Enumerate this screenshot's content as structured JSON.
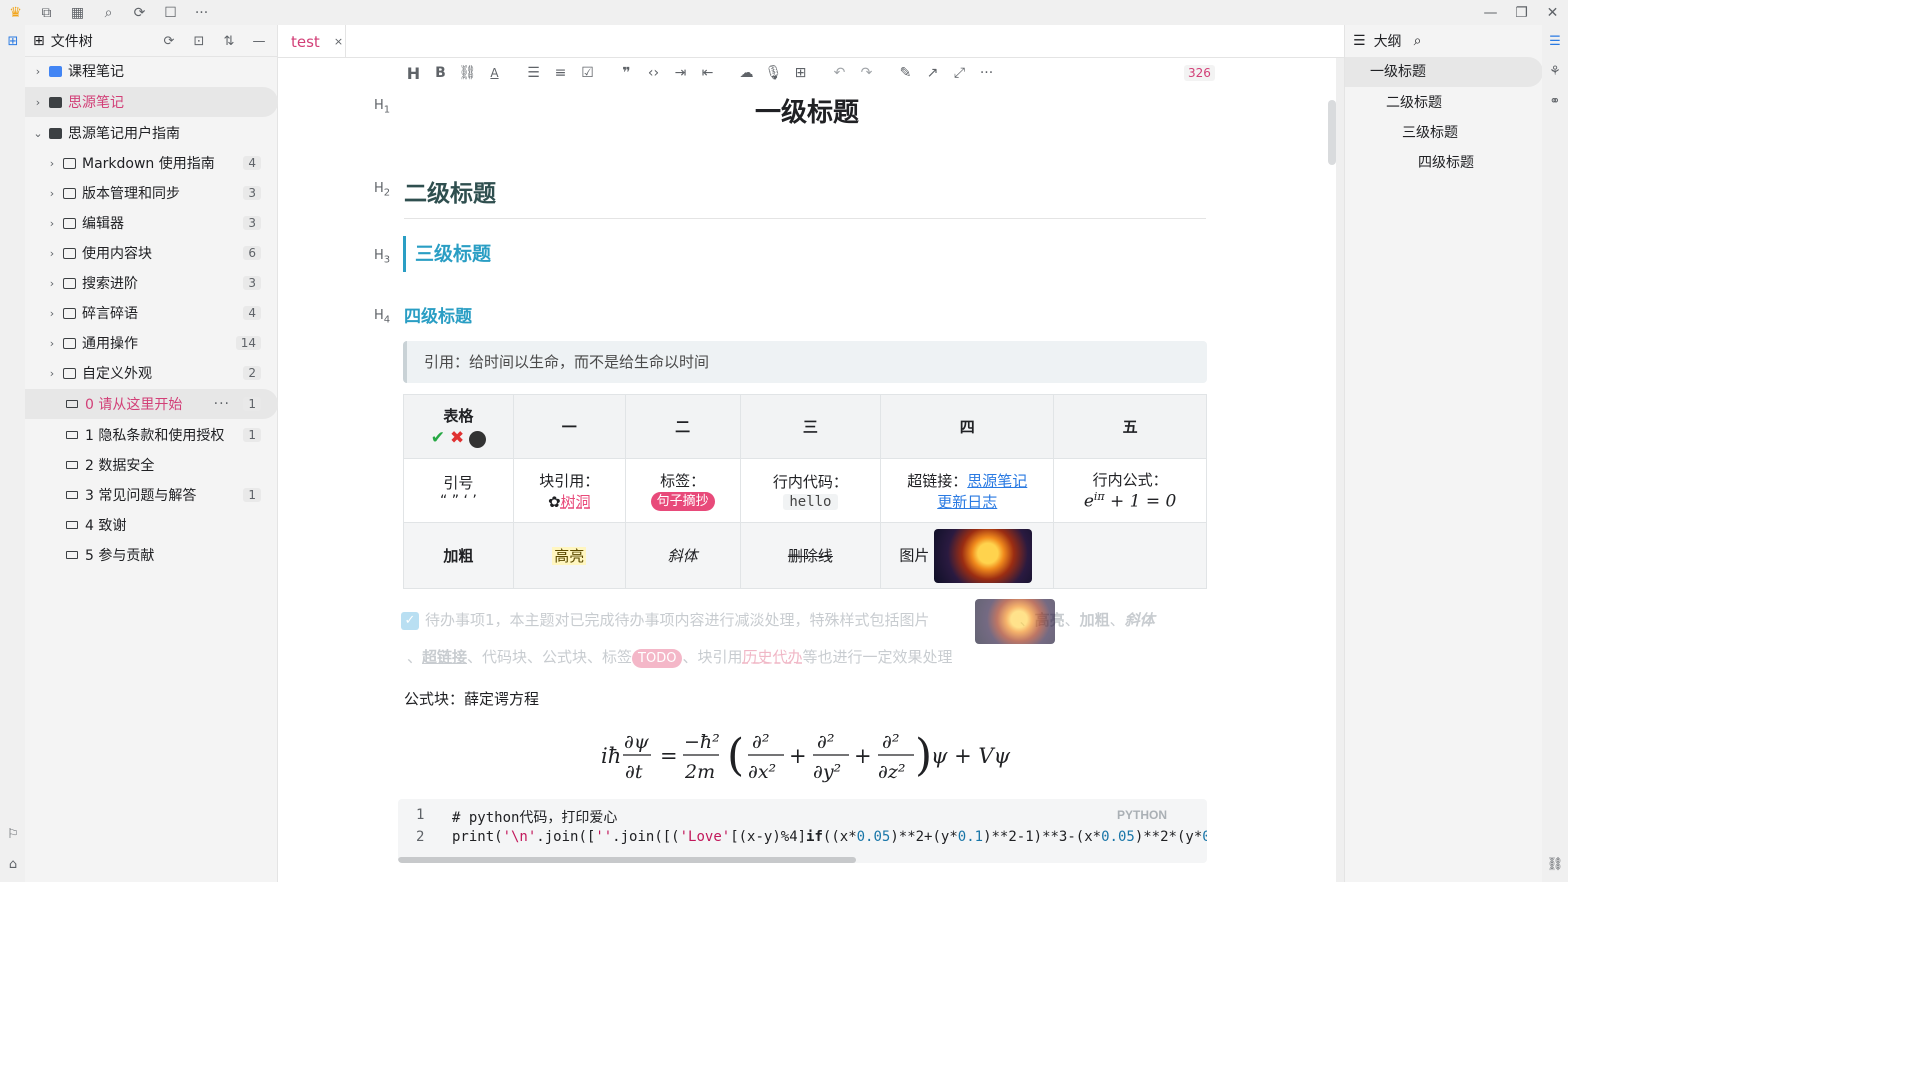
{
  "topbar": {
    "icons": [
      "crown-icon",
      "copy-icon",
      "calendar-icon",
      "search-icon",
      "sync-icon",
      "panel-icon",
      "more-icon"
    ]
  },
  "filetree": {
    "title": "文件树",
    "notebooks": [
      {
        "label": "课程笔记",
        "color": "#4285f4"
      },
      {
        "label": "思源笔记",
        "color": "#3c4043"
      },
      {
        "label": "思源笔记用户指南",
        "color": "#3c4043"
      }
    ],
    "folders": [
      {
        "label": "Markdown 使用指南",
        "count": "4"
      },
      {
        "label": "版本管理和同步",
        "count": "3"
      },
      {
        "label": "编辑器",
        "count": "3"
      },
      {
        "label": "使用内容块",
        "count": "6"
      },
      {
        "label": "搜索进阶",
        "count": "3"
      },
      {
        "label": "碎言碎语",
        "count": "4"
      },
      {
        "label": "通用操作",
        "count": "14"
      },
      {
        "label": "自定义外观",
        "count": "2"
      }
    ],
    "docs": [
      {
        "label": "0 请从这里开始",
        "count": "1",
        "more": "···"
      },
      {
        "label": "1 隐私条款和使用授权",
        "count": "1"
      },
      {
        "label": "2 数据安全",
        "count": ""
      },
      {
        "label": "3 常见问题与解答",
        "count": "1"
      },
      {
        "label": "4 致谢",
        "count": ""
      },
      {
        "label": "5 参与贡献",
        "count": ""
      }
    ]
  },
  "tab": {
    "label": "test",
    "close": "×"
  },
  "toolbar": {
    "buttons": [
      "heading",
      "bold",
      "link",
      "font-color",
      "bullet-list",
      "ordered-list",
      "check-list",
      "quote",
      "code",
      "indent",
      "outdent",
      "upload",
      "record",
      "table",
      "undo",
      "redo",
      "edit",
      "export",
      "fullscreen",
      "more"
    ],
    "word_count": "326"
  },
  "editor": {
    "h1": "一级标题",
    "h2": "二级标题",
    "h3": "三级标题",
    "h4": "四级标题",
    "marks": {
      "h1": "H",
      "h2": "H",
      "h3": "H",
      "h4": "H",
      "n1": "1",
      "n2": "2",
      "n3": "3",
      "n4": "4"
    },
    "quote": "引用：给时间以生命，而不是给生命以时间",
    "table": {
      "headers": [
        "表格",
        "一",
        "二",
        "三",
        "四",
        "五"
      ],
      "row1": {
        "c1_top": "引号",
        "c1_bottom": "“ ” ‘ ’",
        "c2_top": "块引用：",
        "c2_ref": "树洞",
        "c3_top": "标签：",
        "c3_tag": "句子摘抄",
        "c4_top": "行内代码：",
        "c4_code": "hello",
        "c5_top": "超链接：",
        "c5_link1": "思源笔记",
        "c5_link2": "更新日志",
        "c6_top": "行内公式："
      },
      "row2": {
        "c1": "加粗",
        "c2": "高亮",
        "c3": "斜体",
        "c4": "删除线",
        "c5": "图片"
      }
    },
    "todo": {
      "line1": "待办事项1，本主题对已完成待办事项内容进行减淡处理，特殊样式包括图片",
      "line1_tail_a": "、",
      "line1_tail_hl": "高亮",
      "line1_tail_b": "、",
      "line1_tail_bold": "加粗",
      "line1_tail_c": "、",
      "line1_tail_it": "斜体",
      "line2_a": "、",
      "line2_link": "超链接",
      "line2_b": "、代码块、公式块、标签",
      "line2_tag": "TODO",
      "line2_c": "、块引用",
      "line2_ref": "历史代办",
      "line2_d": "等也进行一定效果处理"
    },
    "formula_title": "公式块：薛定谔方程",
    "code": {
      "lang": "PYTHON",
      "line_numbers": [
        "1",
        "2"
      ],
      "line1": "# python代码，打印爱心"
    }
  },
  "outline": {
    "title": "大纲",
    "items": [
      "一级标题",
      "二级标题",
      "三级标题",
      "四级标题"
    ]
  },
  "colors": {
    "accent": "#d23f77",
    "heading": "#2a9ec4",
    "link": "#2a7ae2"
  }
}
